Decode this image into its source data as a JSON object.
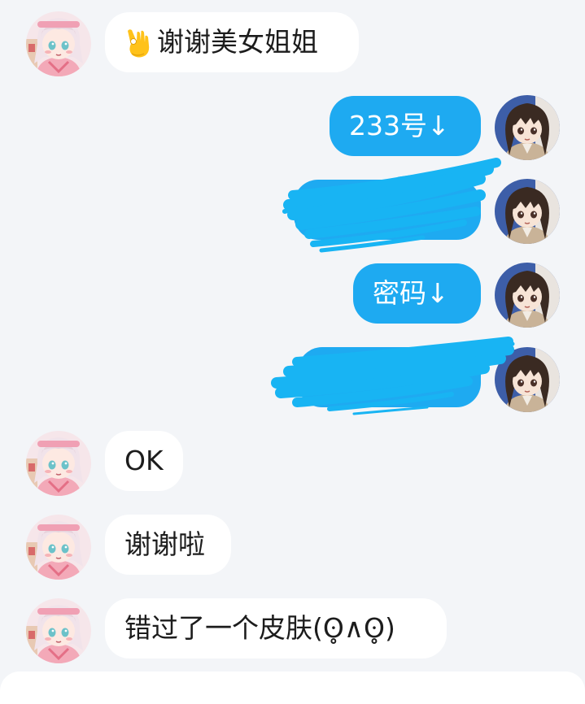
{
  "colors": {
    "background": "#f3f5f8",
    "incoming_bubble": "#ffffff",
    "outgoing_bubble": "#1eaaf1",
    "scribble": "#18b4f3"
  },
  "messages": [
    {
      "side": "in",
      "text": "谢谢美女姐姐",
      "emoji": "ok-hand"
    },
    {
      "side": "out",
      "text": "233号↓"
    },
    {
      "side": "out",
      "text": "",
      "redacted": true
    },
    {
      "side": "out",
      "text": "密码↓"
    },
    {
      "side": "out",
      "text": "",
      "redacted": true
    },
    {
      "side": "in",
      "text": "OK"
    },
    {
      "side": "in",
      "text": "谢谢啦"
    },
    {
      "side": "in",
      "text": "错过了一个皮肤(ʘ̥∧ʘ̥)"
    }
  ]
}
